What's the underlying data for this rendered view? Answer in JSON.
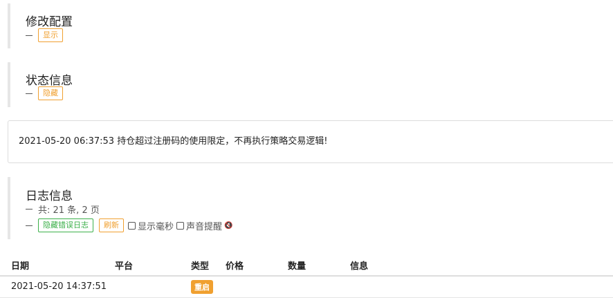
{
  "sections": {
    "config": {
      "title": "修改配置",
      "button": "显示"
    },
    "status": {
      "title": "状态信息",
      "button": "隐藏"
    },
    "log": {
      "title": "日志信息",
      "summary": "共: 21 条, 2 页",
      "hide_errors_button": "隐藏错误日志",
      "refresh_button": "刷新",
      "show_ms_label": "显示毫秒",
      "sound_label": "声音提醒"
    }
  },
  "status_message": "2021-05-20 06:37:53 持仓超过注册码的使用限定，不再执行策略交易逻辑!",
  "table": {
    "headers": [
      "日期",
      "平台",
      "类型",
      "价格",
      "数量",
      "信息"
    ],
    "rows": [
      {
        "date": "2021-05-20 14:37:51",
        "platform": "",
        "type": "重启",
        "price": "",
        "amount": "",
        "info": ""
      }
    ]
  },
  "colors": {
    "accent_orange": "#f0a030",
    "accent_green": "#3cb04a",
    "section_border": "#e6e6e6"
  }
}
